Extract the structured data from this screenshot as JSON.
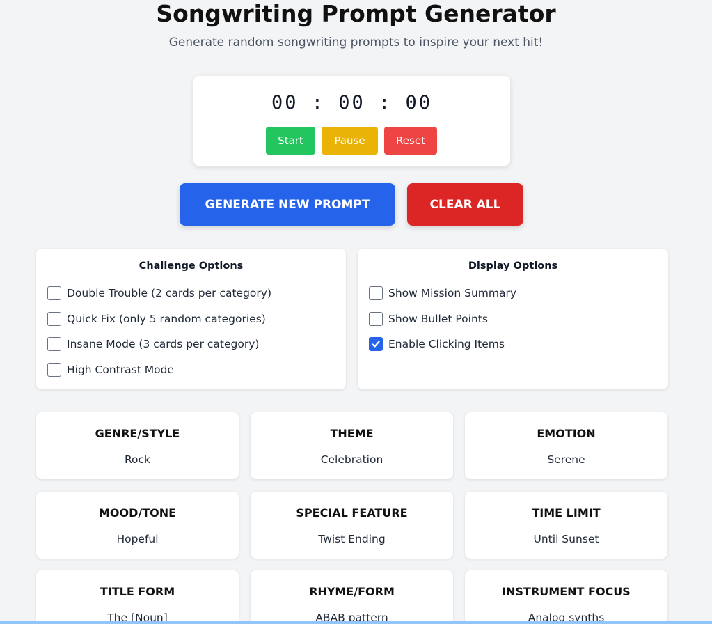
{
  "header": {
    "title": "Songwriting Prompt Generator",
    "subtitle": "Generate random songwriting prompts to inspire your next hit!"
  },
  "timer": {
    "display": "00:00:00",
    "start_label": "Start",
    "pause_label": "Pause",
    "reset_label": "Reset"
  },
  "actions": {
    "generate_label": "GENERATE NEW PROMPT",
    "clear_label": "CLEAR ALL"
  },
  "challenge_options": {
    "heading": "Challenge Options",
    "items": [
      {
        "label": "Double Trouble (2 cards per category)",
        "checked": false
      },
      {
        "label": "Quick Fix (only 5 random categories)",
        "checked": false
      },
      {
        "label": "Insane Mode (3 cards per category)",
        "checked": false
      },
      {
        "label": "High Contrast Mode",
        "checked": false
      }
    ]
  },
  "display_options": {
    "heading": "Display Options",
    "items": [
      {
        "label": "Show Mission Summary",
        "checked": false
      },
      {
        "label": "Show Bullet Points",
        "checked": false
      },
      {
        "label": "Enable Clicking Items",
        "checked": true
      }
    ]
  },
  "categories": [
    {
      "title": "GENRE/STYLE",
      "value": "Rock"
    },
    {
      "title": "THEME",
      "value": "Celebration"
    },
    {
      "title": "EMOTION",
      "value": "Serene"
    },
    {
      "title": "MOOD/TONE",
      "value": "Hopeful"
    },
    {
      "title": "SPECIAL FEATURE",
      "value": "Twist Ending"
    },
    {
      "title": "TIME LIMIT",
      "value": "Until Sunset"
    },
    {
      "title": "TITLE FORM",
      "value": "The [Noun]"
    },
    {
      "title": "RHYME/FORM",
      "value": "ABAB pattern"
    },
    {
      "title": "INSTRUMENT FOCUS",
      "value": "Analog synths"
    }
  ],
  "colors": {
    "start": "#22c55e",
    "pause": "#eab308",
    "reset": "#ef4444",
    "generate": "#2563eb",
    "clear": "#dc2626",
    "checkbox_checked": "#2563eb"
  }
}
